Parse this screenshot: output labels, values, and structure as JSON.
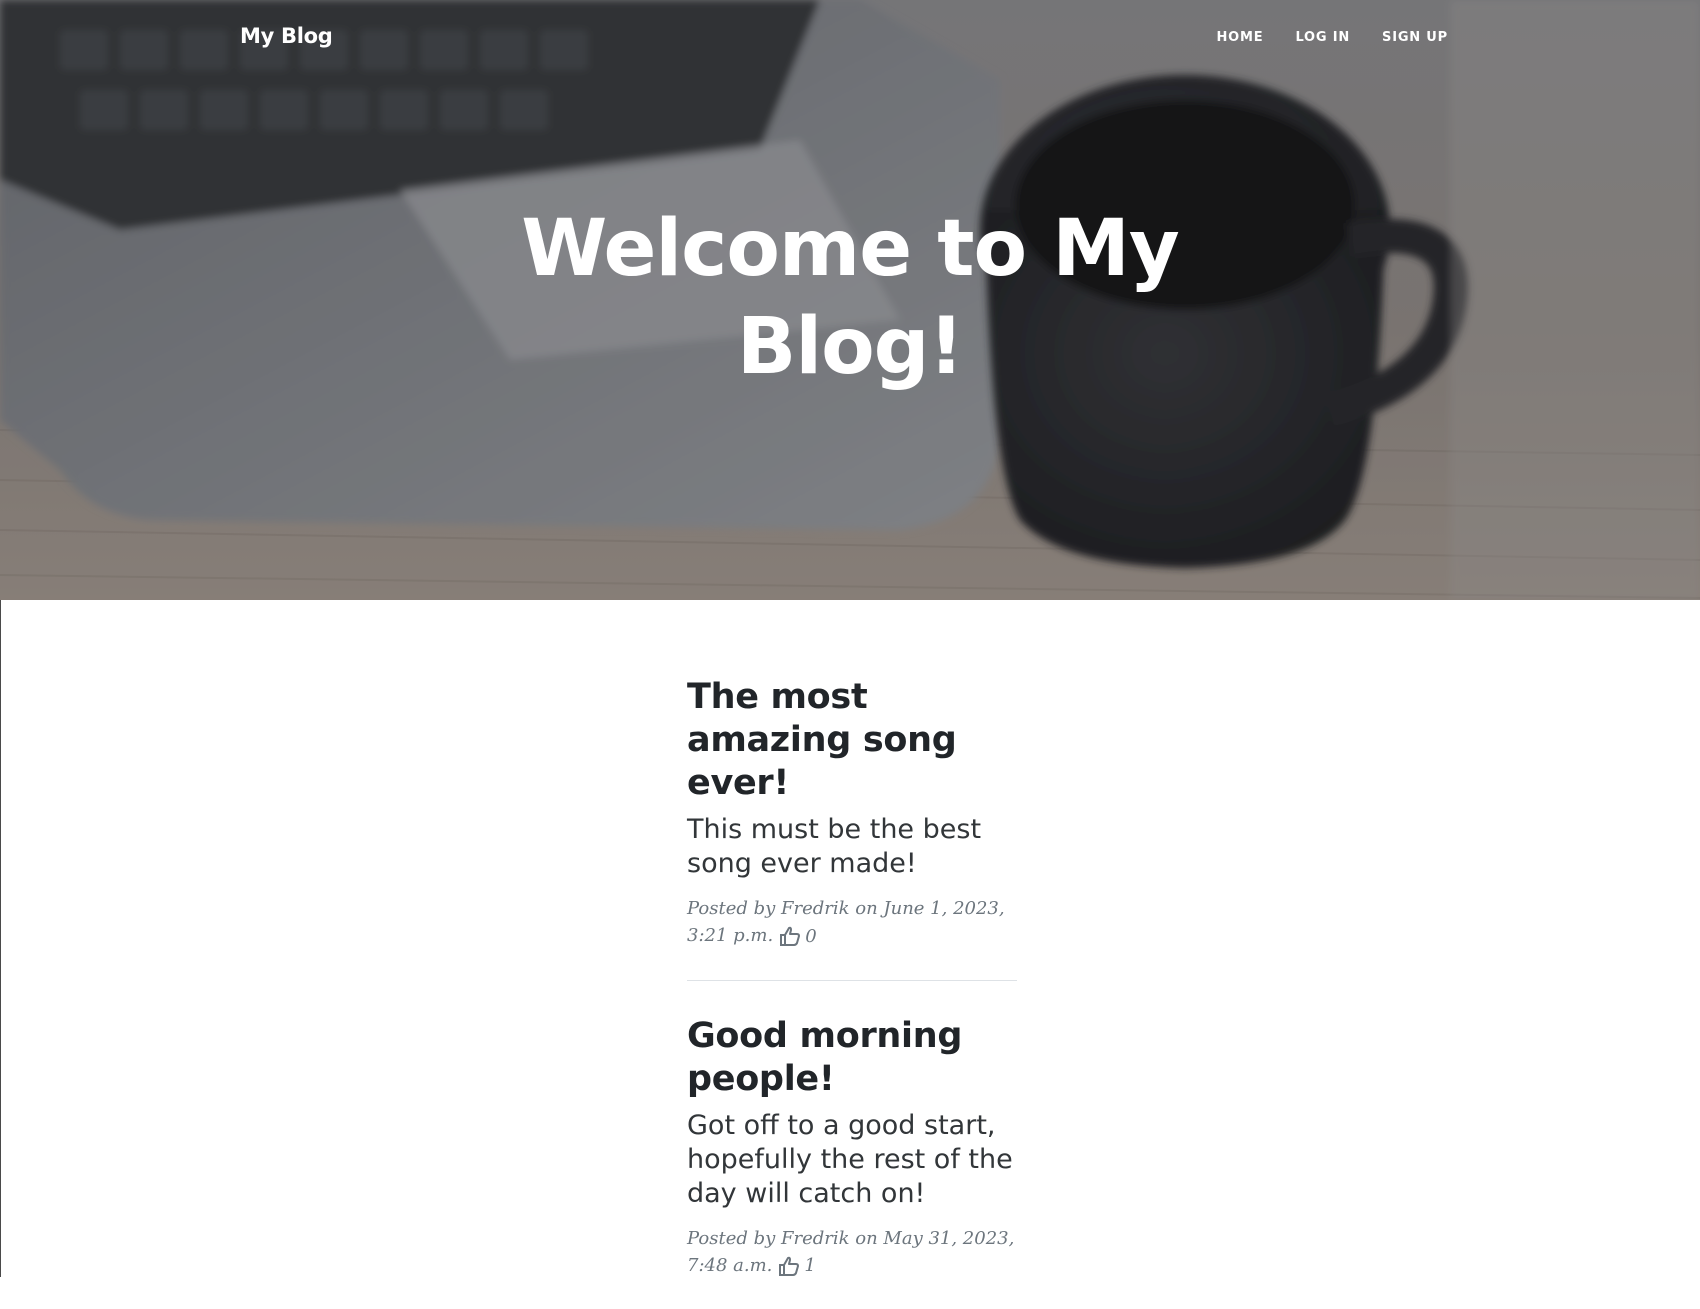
{
  "navbar": {
    "brand": "My Blog",
    "links": [
      "HOME",
      "LOG IN",
      "SIGN UP"
    ]
  },
  "hero": {
    "title": "Welcome to My Blog!"
  },
  "posts": [
    {
      "title": "The most amazing song ever!",
      "subtitle": "This must be the best song ever made!",
      "meta_prefix": "Posted by Fredrik on June 1, 2023, 3:21 p.m.",
      "likes": "0"
    },
    {
      "title": "Good morning people!",
      "subtitle": "Got off to a good start, hopefully the rest of the day will catch on!",
      "meta_prefix": "Posted by Fredrik on May 31, 2023, 7:48 a.m.",
      "likes": "1"
    }
  ],
  "icons": {
    "like": "thumbs-up-icon"
  }
}
